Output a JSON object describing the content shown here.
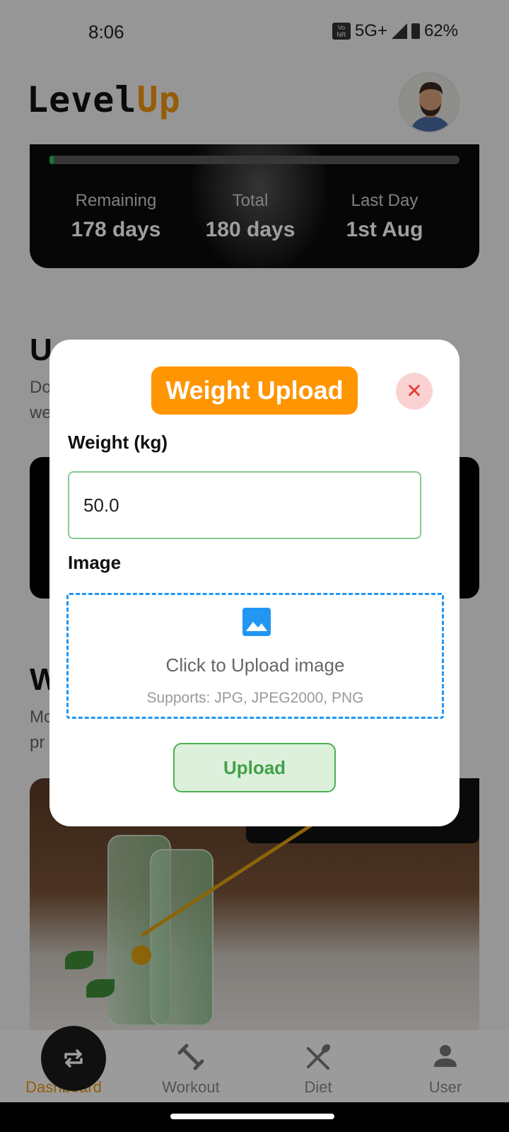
{
  "status_bar": {
    "time": "8:06",
    "volte": "Vo NR",
    "network": "5G+",
    "battery": "62%"
  },
  "app": {
    "logo_part1": "Level",
    "logo_part2": "Up",
    "brand_color": "#f0960d"
  },
  "progress_card": {
    "progress_fraction": 0.011,
    "stats": [
      {
        "label": "Remaining",
        "value": "178 days"
      },
      {
        "label": "Total",
        "value": "180 days"
      },
      {
        "label": "Last Day",
        "value": "1st Aug"
      }
    ]
  },
  "sections": {
    "upload_weight": {
      "title_visible": "U",
      "desc_line1": "Do",
      "desc_line2": "we"
    },
    "weight_progress": {
      "title_visible": "W",
      "desc_line1": "Mo",
      "desc_line2": "pr"
    }
  },
  "dialog": {
    "title": "Weight Upload",
    "close_icon": "close-icon",
    "weight_label": "Weight (kg)",
    "weight_value": "50.0",
    "image_label": "Image",
    "dropzone_text": "Click to Upload image",
    "dropzone_hint": "Supports: JPG, JPEG2000, PNG",
    "upload_label": "Upload",
    "accent_title": "#ff9500",
    "accent_upload": "#43a047",
    "accent_dropzone": "#2196f3"
  },
  "bottom_nav": {
    "items": [
      {
        "label": "Dashboard",
        "icon": "dashboard-icon",
        "active": true
      },
      {
        "label": "Workout",
        "icon": "dumbbell-icon",
        "active": false
      },
      {
        "label": "Diet",
        "icon": "fork-spoon-icon",
        "active": false
      },
      {
        "label": "User",
        "icon": "user-icon",
        "active": false
      }
    ],
    "fab_icon": "repeat-icon"
  }
}
